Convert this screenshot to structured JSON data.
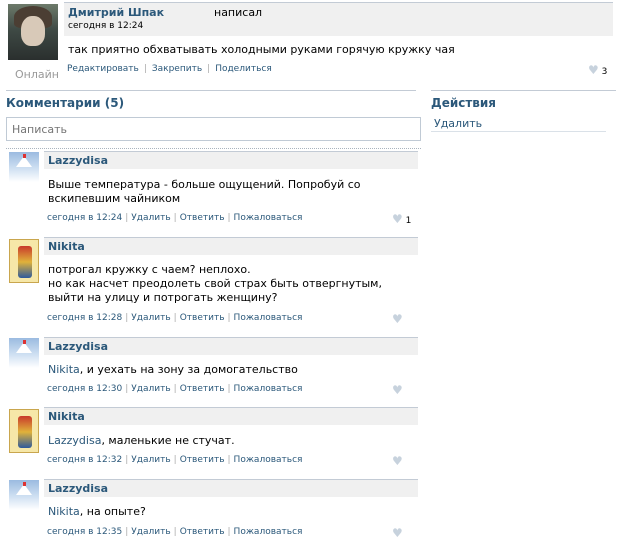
{
  "post": {
    "author": "Дмитрий Шпак",
    "verb": "написал",
    "date": "сегодня в 12:24",
    "text": "так приятно обхватывать холодными руками горячую кружку чая",
    "status": "Онлайн",
    "actions": [
      "Редактировать",
      "Закрепить",
      "Поделиться"
    ],
    "likes": "3"
  },
  "comments_section": {
    "title": "Комментарии (5)",
    "input_placeholder": "Написать"
  },
  "actions_section": {
    "title": "Действия",
    "delete": "Удалить"
  },
  "comment_actions": {
    "delete": "Удалить",
    "reply": "Ответить",
    "report": "Пожаловаться"
  },
  "comments": [
    {
      "author": "Lazzydisa",
      "avatar": "mountain-avatar",
      "text": "Выше температура - больше ощущений. Попробуй со вскипевшим чайником",
      "mention": "",
      "date": "сегодня в 12:24",
      "likes": "1"
    },
    {
      "author": "Nikita",
      "avatar": "playing-card-avatar",
      "text": "потрогал кружку с чаем? неплохо.\nно как насчет преодолеть свой страх быть отвергнутым, выйти на улицу и потрогать женщину?",
      "mention": "",
      "date": "сегодня в 12:28",
      "likes": ""
    },
    {
      "author": "Lazzydisa",
      "avatar": "mountain-avatar",
      "text": ", и уехать на зону за домогательство",
      "mention": "Nikita",
      "date": "сегодня в 12:30",
      "likes": ""
    },
    {
      "author": "Nikita",
      "avatar": "playing-card-avatar",
      "text": ", маленькие не стучат.",
      "mention": "Lazzydisa",
      "date": "сегодня в 12:32",
      "likes": ""
    },
    {
      "author": "Lazzydisa",
      "avatar": "mountain-avatar",
      "text": ", на опыте?",
      "mention": "Nikita",
      "date": "сегодня в 12:35",
      "likes": ""
    }
  ],
  "colors": {
    "link": "#2b587a",
    "header_bg": "#f0f0f0",
    "border": "#c3cbd5",
    "muted": "#999999"
  }
}
